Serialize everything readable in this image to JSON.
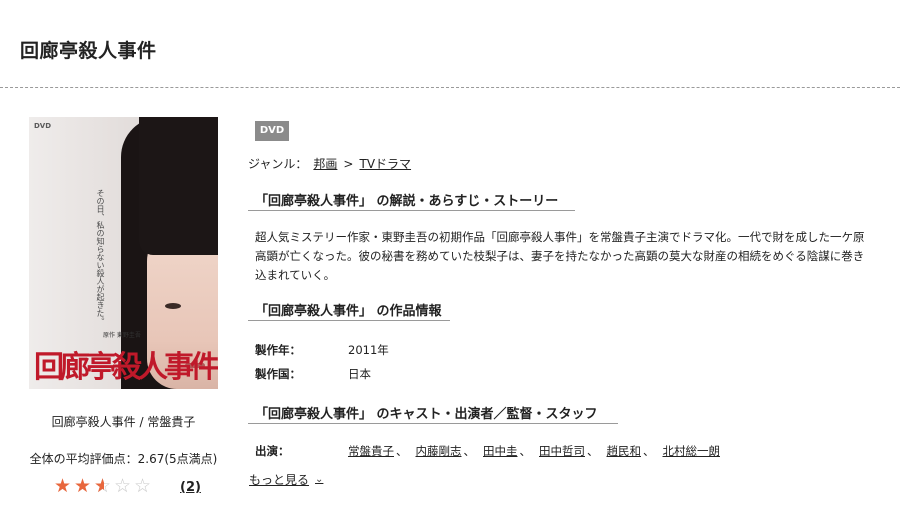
{
  "page": {
    "title": "回廊亭殺人事件"
  },
  "cover": {
    "dvd_logo": "DVD",
    "vertical_line_1": "その日、私の知らない殺人が起きた。",
    "vertical_line_2": "",
    "credit": "原作 東野圭吾",
    "title_text": "回廊亭殺人事件"
  },
  "left": {
    "caption": "回廊亭殺人事件 / 常盤貴子",
    "rating_text": "全体の平均評価点：2.67(5点満点)",
    "rating_value": 2.67,
    "rating_max": 5,
    "review_count": "(2)"
  },
  "badge": "DVD",
  "genre": {
    "label": "ジャンル：",
    "items": [
      "邦画",
      "TVドラマ"
    ],
    "separator": ">"
  },
  "sections": {
    "synopsis_heading": "「回廊亭殺人事件」 の解説・あらすじ・ストーリー",
    "synopsis_text": "超人気ミステリー作家・東野圭吾の初期作品「回廊亭殺人事件」を常盤貴子主演でドラマ化。一代で財を成した一ケ原高顕が亡くなった。彼の秘書を務めていた枝梨子は、妻子を持たなかった高顕の莫大な財産の相続をめぐる陰謀に巻き込まれていく。",
    "info_heading": "「回廊亭殺人事件」 の作品情報",
    "cast_heading": "「回廊亭殺人事件」 のキャスト・出演者／監督・スタッフ"
  },
  "info": [
    {
      "label": "製作年：",
      "value": "2011年"
    },
    {
      "label": "製作国：",
      "value": "日本"
    }
  ],
  "cast": {
    "label": "出演：",
    "names": [
      "常盤貴子",
      "内藤剛志",
      "田中圭",
      "田中哲司",
      "趙民和",
      "北村総一朗"
    ],
    "separator": "、"
  },
  "more_label": "もっと見る",
  "colors": {
    "star_fill": "#e8673d",
    "badge_bg": "#8b8b8b",
    "cover_title": "#c0192a"
  }
}
